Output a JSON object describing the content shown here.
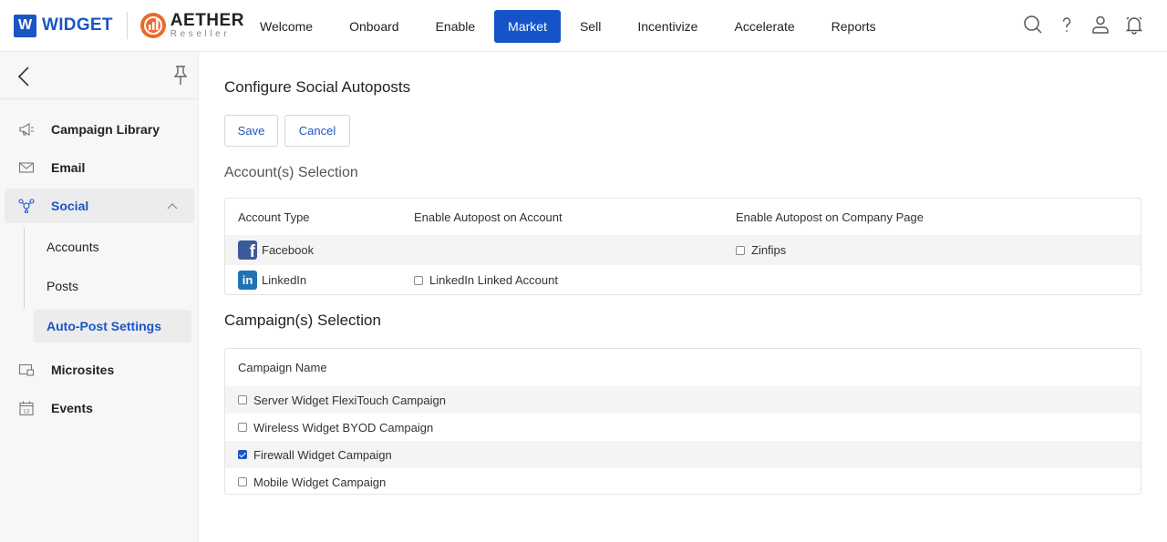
{
  "brand": {
    "w_letter": "W",
    "w_name": "WIDGET",
    "aether_name": "AETHER",
    "aether_sub": "Reseller"
  },
  "nav": [
    {
      "label": "Welcome",
      "name": "nav-welcome"
    },
    {
      "label": "Onboard",
      "name": "nav-onboard"
    },
    {
      "label": "Enable",
      "name": "nav-enable"
    },
    {
      "label": "Market",
      "name": "nav-market",
      "active": true
    },
    {
      "label": "Sell",
      "name": "nav-sell"
    },
    {
      "label": "Incentivize",
      "name": "nav-incentivize"
    },
    {
      "label": "Accelerate",
      "name": "nav-accelerate"
    },
    {
      "label": "Reports",
      "name": "nav-reports"
    }
  ],
  "top_icons": [
    "search-icon",
    "help-icon",
    "user-icon",
    "bell-icon"
  ],
  "sidebar": {
    "items": [
      {
        "label": "Campaign Library",
        "icon": "megaphone-icon"
      },
      {
        "label": "Email",
        "icon": "envelope-icon"
      },
      {
        "label": "Social",
        "icon": "social-network-icon",
        "active": true
      },
      {
        "label": "Microsites",
        "icon": "microsite-icon"
      },
      {
        "label": "Events",
        "icon": "calendar-icon"
      }
    ],
    "social_sub": [
      {
        "label": "Accounts"
      },
      {
        "label": "Posts"
      },
      {
        "label": "Auto-Post Settings",
        "active": true
      }
    ]
  },
  "page": {
    "title": "Configure Social Autoposts",
    "save_label": "Save",
    "cancel_label": "Cancel",
    "accounts_section": "Account(s) Selection",
    "campaigns_section": "Campaign(s) Selection"
  },
  "accounts_table": {
    "headers": [
      "Account Type",
      "Enable Autopost on Account",
      "Enable Autopost on Company Page"
    ],
    "rows": [
      {
        "type": "Facebook",
        "icon": "facebook-icon",
        "account_option": "",
        "company_option": "Zinfips",
        "company_checked": false
      },
      {
        "type": "LinkedIn",
        "icon": "linkedin-icon",
        "account_option": "LinkedIn Linked Account",
        "account_checked": false,
        "company_option": ""
      }
    ]
  },
  "campaigns_table": {
    "header": "Campaign Name",
    "rows": [
      {
        "name": "Server Widget FlexiTouch Campaign",
        "checked": false
      },
      {
        "name": "Wireless Widget BYOD Campaign",
        "checked": false
      },
      {
        "name": "Firewall Widget Campaign",
        "checked": true
      },
      {
        "name": "Mobile Widget Campaign",
        "checked": false
      }
    ]
  },
  "colors": {
    "primary": "#1454c8",
    "brand_blue": "#1a56c4",
    "aether_orange": "#ec6a2c",
    "sidebar_bg": "#f7f7f7"
  }
}
